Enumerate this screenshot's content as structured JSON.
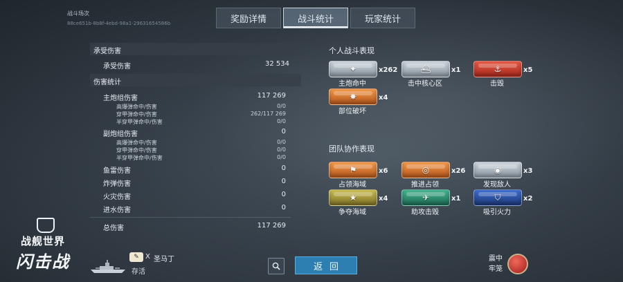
{
  "header": {
    "match_title": "战斗场次",
    "match_id": "88ce651b-8b8f-4ebd-98a1-29631654586b",
    "tabs": [
      "奖励详情",
      "战斗统计",
      "玩家统计"
    ],
    "active_tab": 1
  },
  "damage_taken": {
    "section_title": "承受伤害",
    "label": "承受伤害",
    "value": "32 534"
  },
  "damage_stats": {
    "section_title": "伤害统计",
    "main_battery": {
      "label": "主炮组伤害",
      "value": "117 269"
    },
    "main_sub": [
      {
        "label": "高爆弹命中/伤害",
        "value": "0/0"
      },
      {
        "label": "穿甲弹命中/伤害",
        "value": "262/117 269"
      },
      {
        "label": "半穿甲弹命中/伤害",
        "value": "0/0"
      }
    ],
    "secondary": {
      "label": "副炮组伤害",
      "value": "0"
    },
    "secondary_sub": [
      {
        "label": "高爆弹命中/伤害",
        "value": "0/0"
      },
      {
        "label": "穿甲弹命中/伤害",
        "value": "0/0"
      },
      {
        "label": "半穿甲弹命中/伤害",
        "value": "0/0"
      }
    ],
    "torpedo": {
      "label": "鱼雷伤害",
      "value": "0"
    },
    "bomb": {
      "label": "炸弹伤害",
      "value": "0"
    },
    "fire": {
      "label": "火灾伤害",
      "value": "0"
    },
    "flood": {
      "label": "进水伤害",
      "value": "0"
    },
    "total": {
      "label": "总伤害",
      "value": "117 269"
    }
  },
  "personal": {
    "title": "个人战斗表现",
    "medals": [
      {
        "name": "主炮命中",
        "count": "x262",
        "color": "silver",
        "icon": "cannon-icon"
      },
      {
        "name": "击中核心区",
        "count": "x1",
        "color": "silver",
        "icon": "ship-icon"
      },
      {
        "name": "击毁",
        "count": "x5",
        "color": "red",
        "icon": "sinking-ship-icon"
      },
      {
        "name": "部位破坏",
        "count": "x4",
        "color": "orange",
        "icon": "explosion-icon"
      }
    ]
  },
  "team": {
    "title": "团队协作表现",
    "medals": [
      {
        "name": "占领海域",
        "count": "x6",
        "color": "orange",
        "icon": "flag-icon"
      },
      {
        "name": "推进占领",
        "count": "x26",
        "color": "orange",
        "icon": "target-icon"
      },
      {
        "name": "发现敌人",
        "count": "x3",
        "color": "silver",
        "icon": "radar-icon"
      },
      {
        "name": "争夺海域",
        "count": "x4",
        "color": "olive",
        "icon": "star-flag-icon"
      },
      {
        "name": "助攻击毁",
        "count": "x1",
        "color": "green",
        "icon": "assist-icon"
      },
      {
        "name": "吸引火力",
        "count": "x2",
        "color": "blue",
        "icon": "shield-ship-icon"
      }
    ]
  },
  "footer": {
    "logo_line1": "战舰世界",
    "logo_line2": "闪击战",
    "player_x": "X",
    "player_name": "圣马丁",
    "player_status": "存活",
    "back_label": "返回",
    "role_label": "震中牢笼"
  }
}
